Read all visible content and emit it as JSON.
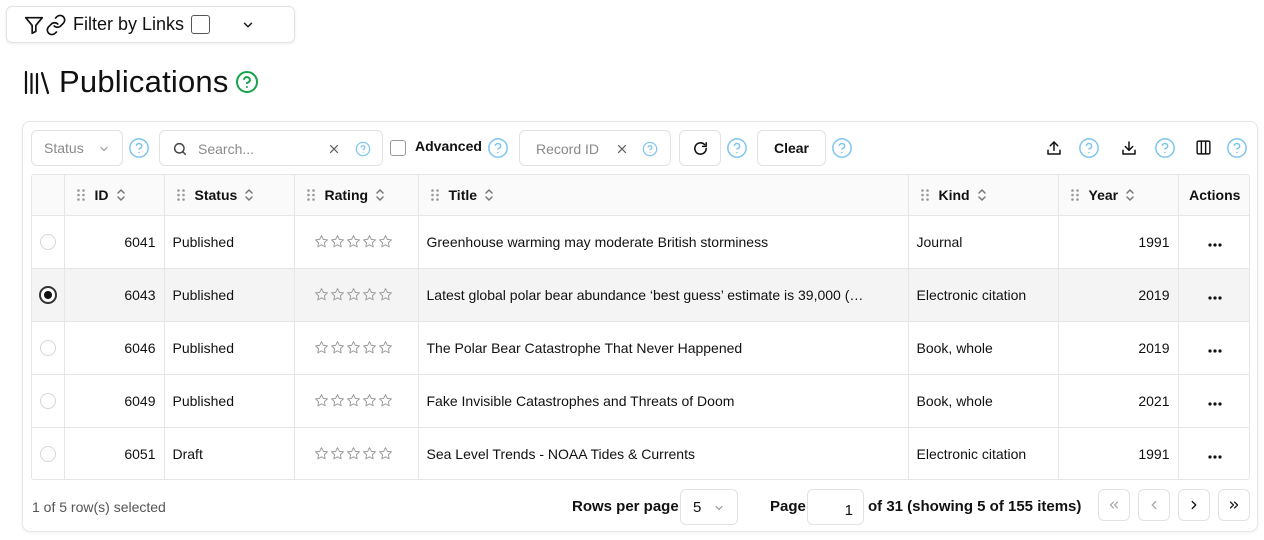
{
  "filter_links": {
    "label": "Filter by Links"
  },
  "page": {
    "title": "Publications"
  },
  "toolbar": {
    "status_placeholder": "Status",
    "search_placeholder": "Search...",
    "advanced_label": "Advanced",
    "record_id_placeholder": "Record ID",
    "clear_label": "Clear"
  },
  "table": {
    "columns": [
      "ID",
      "Status",
      "Rating",
      "Title",
      "Kind",
      "Year",
      "Actions"
    ],
    "rows": [
      {
        "id": "6041",
        "status": "Published",
        "rating": 0,
        "title": "Greenhouse warming may moderate British storminess",
        "kind": "Journal",
        "year": "1991",
        "selected": false
      },
      {
        "id": "6043",
        "status": "Published",
        "rating": 0,
        "title": "Latest global polar bear abundance ‘best guess’ estimate is 39,000 (…",
        "kind": "Electronic citation",
        "year": "2019",
        "selected": true
      },
      {
        "id": "6046",
        "status": "Published",
        "rating": 0,
        "title": "The Polar Bear Catastrophe That Never Happened",
        "kind": "Book, whole",
        "year": "2019",
        "selected": false
      },
      {
        "id": "6049",
        "status": "Published",
        "rating": 0,
        "title": "Fake Invisible Catastrophes and Threats of Doom",
        "kind": "Book, whole",
        "year": "2021",
        "selected": false
      },
      {
        "id": "6051",
        "status": "Draft",
        "rating": 0,
        "title": "Sea Level Trends - NOAA Tides & Currents",
        "kind": "Electronic citation",
        "year": "1991",
        "selected": false
      }
    ]
  },
  "footer": {
    "selection_text": "1 of 5 row(s) selected",
    "rows_per_page_label": "Rows per page",
    "rows_per_page_value": "5",
    "page_label": "Page",
    "page_value": "1",
    "page_of_text": "of 31 (showing 5 of 155 items)"
  },
  "colors": {
    "help_blue": "#7cc4ee",
    "help_green": "#16a34a",
    "border": "#e6e6e6",
    "selected_row": "#f4f4f4"
  }
}
